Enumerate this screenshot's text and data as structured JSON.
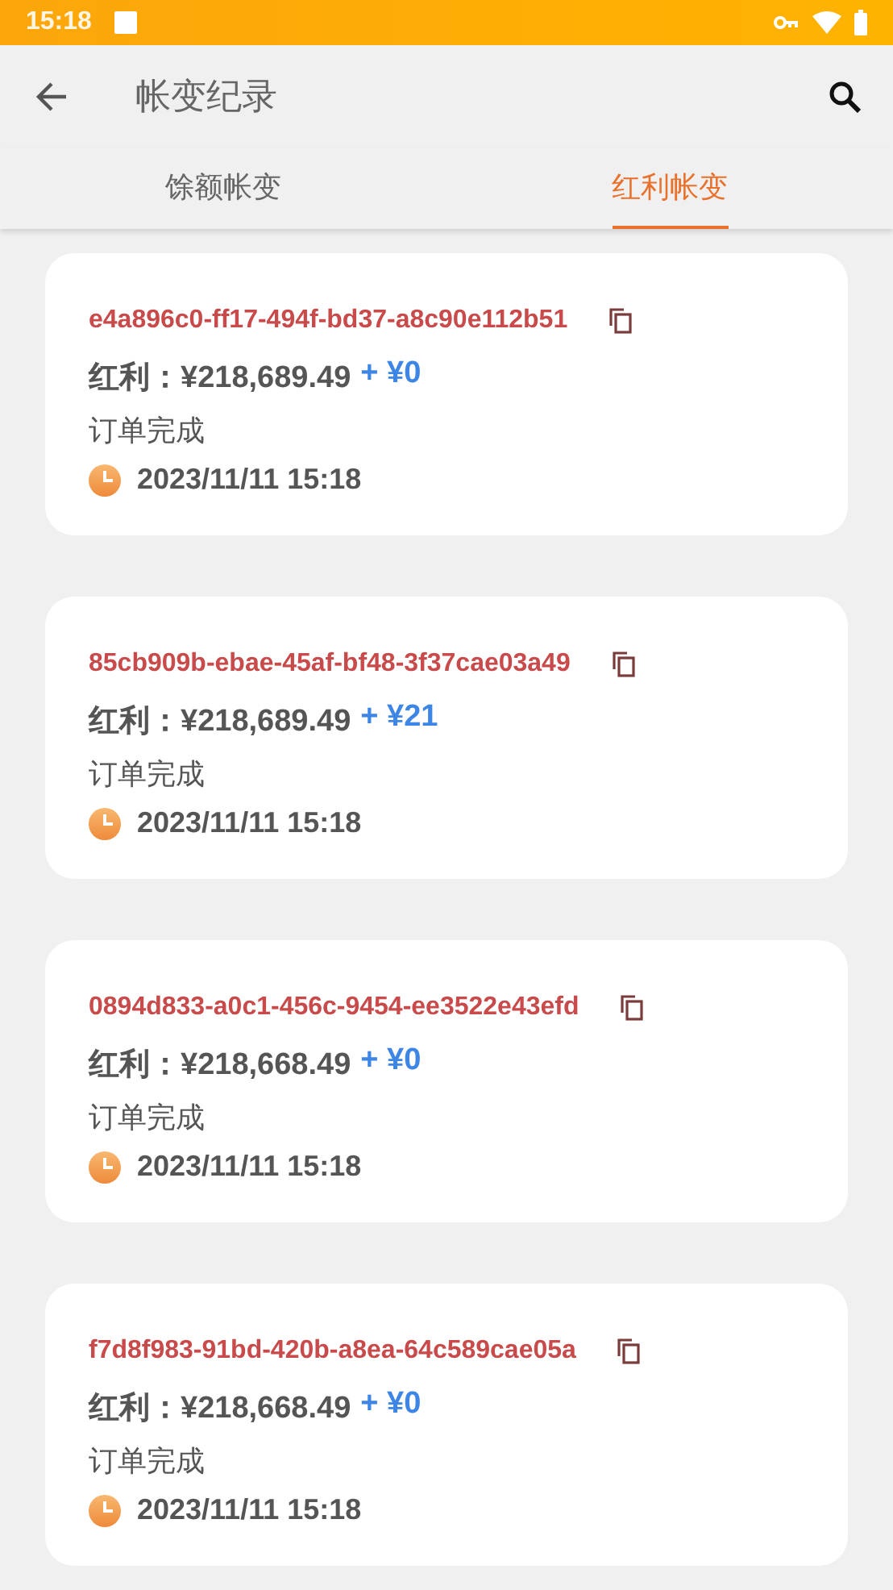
{
  "status_bar": {
    "time": "15:18"
  },
  "app_bar": {
    "title": "帐变纪录"
  },
  "tabs": [
    {
      "label": "馀额帐变",
      "selected": false
    },
    {
      "label": "红利帐变",
      "selected": true
    }
  ],
  "records": [
    {
      "id": "e4a896c0-ff17-494f-bd37-a8c90e112b51",
      "balance": "红利：¥218,689.49",
      "change": "+ ¥0",
      "status": "订单完成",
      "time": "2023/11/11 15:18"
    },
    {
      "id": "85cb909b-ebae-45af-bf48-3f37cae03a49",
      "balance": "红利：¥218,689.49",
      "change": "+ ¥21",
      "status": "订单完成",
      "time": "2023/11/11 15:18"
    },
    {
      "id": "0894d833-a0c1-456c-9454-ee3522e43efd",
      "balance": "红利：¥218,668.49",
      "change": "+ ¥0",
      "status": "订单完成",
      "time": "2023/11/11 15:18"
    },
    {
      "id": "f7d8f983-91bd-420b-a8ea-64c589cae05a",
      "balance": "红利：¥218,668.49",
      "change": "+ ¥0",
      "status": "订单完成",
      "time": "2023/11/11 15:18"
    }
  ]
}
